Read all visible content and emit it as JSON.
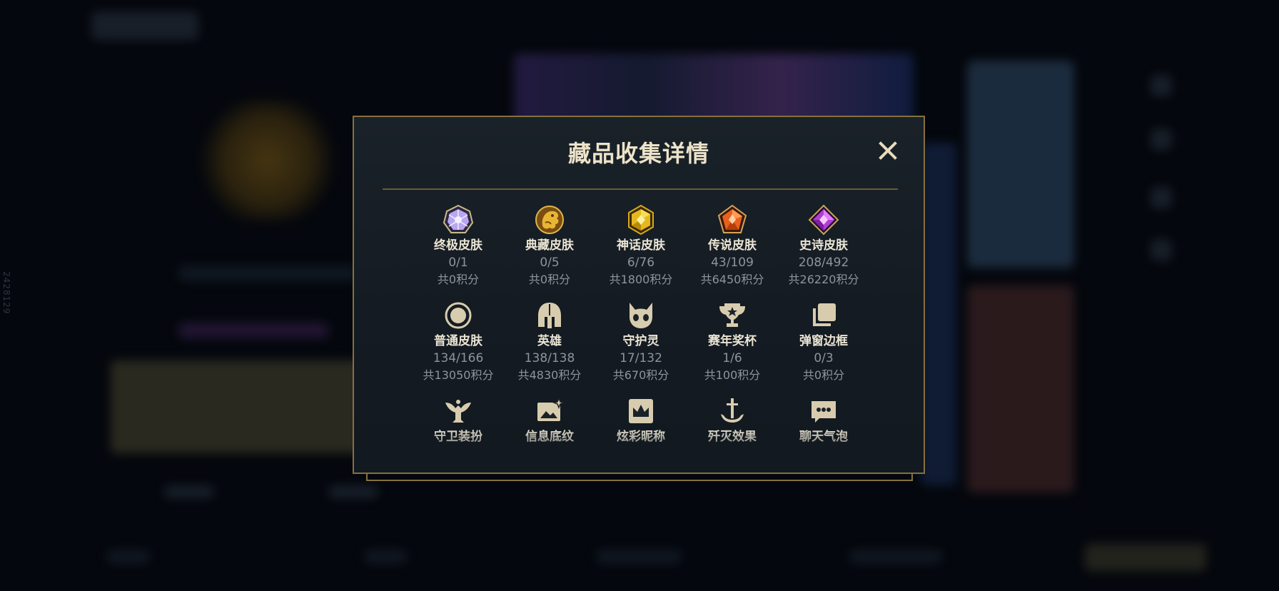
{
  "background": {
    "side_number": "2428129"
  },
  "modal": {
    "title": "藏品收集详情",
    "close_icon": "close-icon",
    "categories": [
      {
        "name": "终极皮肤",
        "count": "0/1",
        "points": "共0积分",
        "icon": "ultimate-gem-icon"
      },
      {
        "name": "典藏皮肤",
        "count": "0/5",
        "points": "共0积分",
        "icon": "dragon-gem-icon"
      },
      {
        "name": "神话皮肤",
        "count": "6/76",
        "points": "共1800积分",
        "icon": "mythic-gem-icon"
      },
      {
        "name": "传说皮肤",
        "count": "43/109",
        "points": "共6450积分",
        "icon": "legendary-gem-icon"
      },
      {
        "name": "史诗皮肤",
        "count": "208/492",
        "points": "共26220积分",
        "icon": "epic-gem-icon"
      },
      {
        "name": "普通皮肤",
        "count": "134/166",
        "points": "共13050积分",
        "icon": "ring-icon"
      },
      {
        "name": "英雄",
        "count": "138/138",
        "points": "共4830积分",
        "icon": "helmet-icon"
      },
      {
        "name": "守护灵",
        "count": "17/132",
        "points": "共670积分",
        "icon": "little-legend-icon"
      },
      {
        "name": "赛年奖杯",
        "count": "1/6",
        "points": "共100积分",
        "icon": "trophy-icon"
      },
      {
        "name": "弹窗边框",
        "count": "0/3",
        "points": "共0积分",
        "icon": "stacked-frames-icon"
      },
      {
        "name": "守卫装扮",
        "icon": "ward-icon"
      },
      {
        "name": "信息底纹",
        "icon": "banner-image-icon"
      },
      {
        "name": "炫彩昵称",
        "icon": "crown-card-icon"
      },
      {
        "name": "歼灭效果",
        "icon": "anchor-sword-icon"
      },
      {
        "name": "聊天气泡",
        "icon": "chat-bubble-icon"
      }
    ]
  },
  "colors": {
    "accent_gold": "#86703e",
    "title_text": "#ede3c9",
    "muted_text": "#8f949a",
    "ultimate": "#b9a6f0",
    "mythic": "#e6b820",
    "legendary": "#e8601f",
    "epic": "#b13cd6"
  }
}
